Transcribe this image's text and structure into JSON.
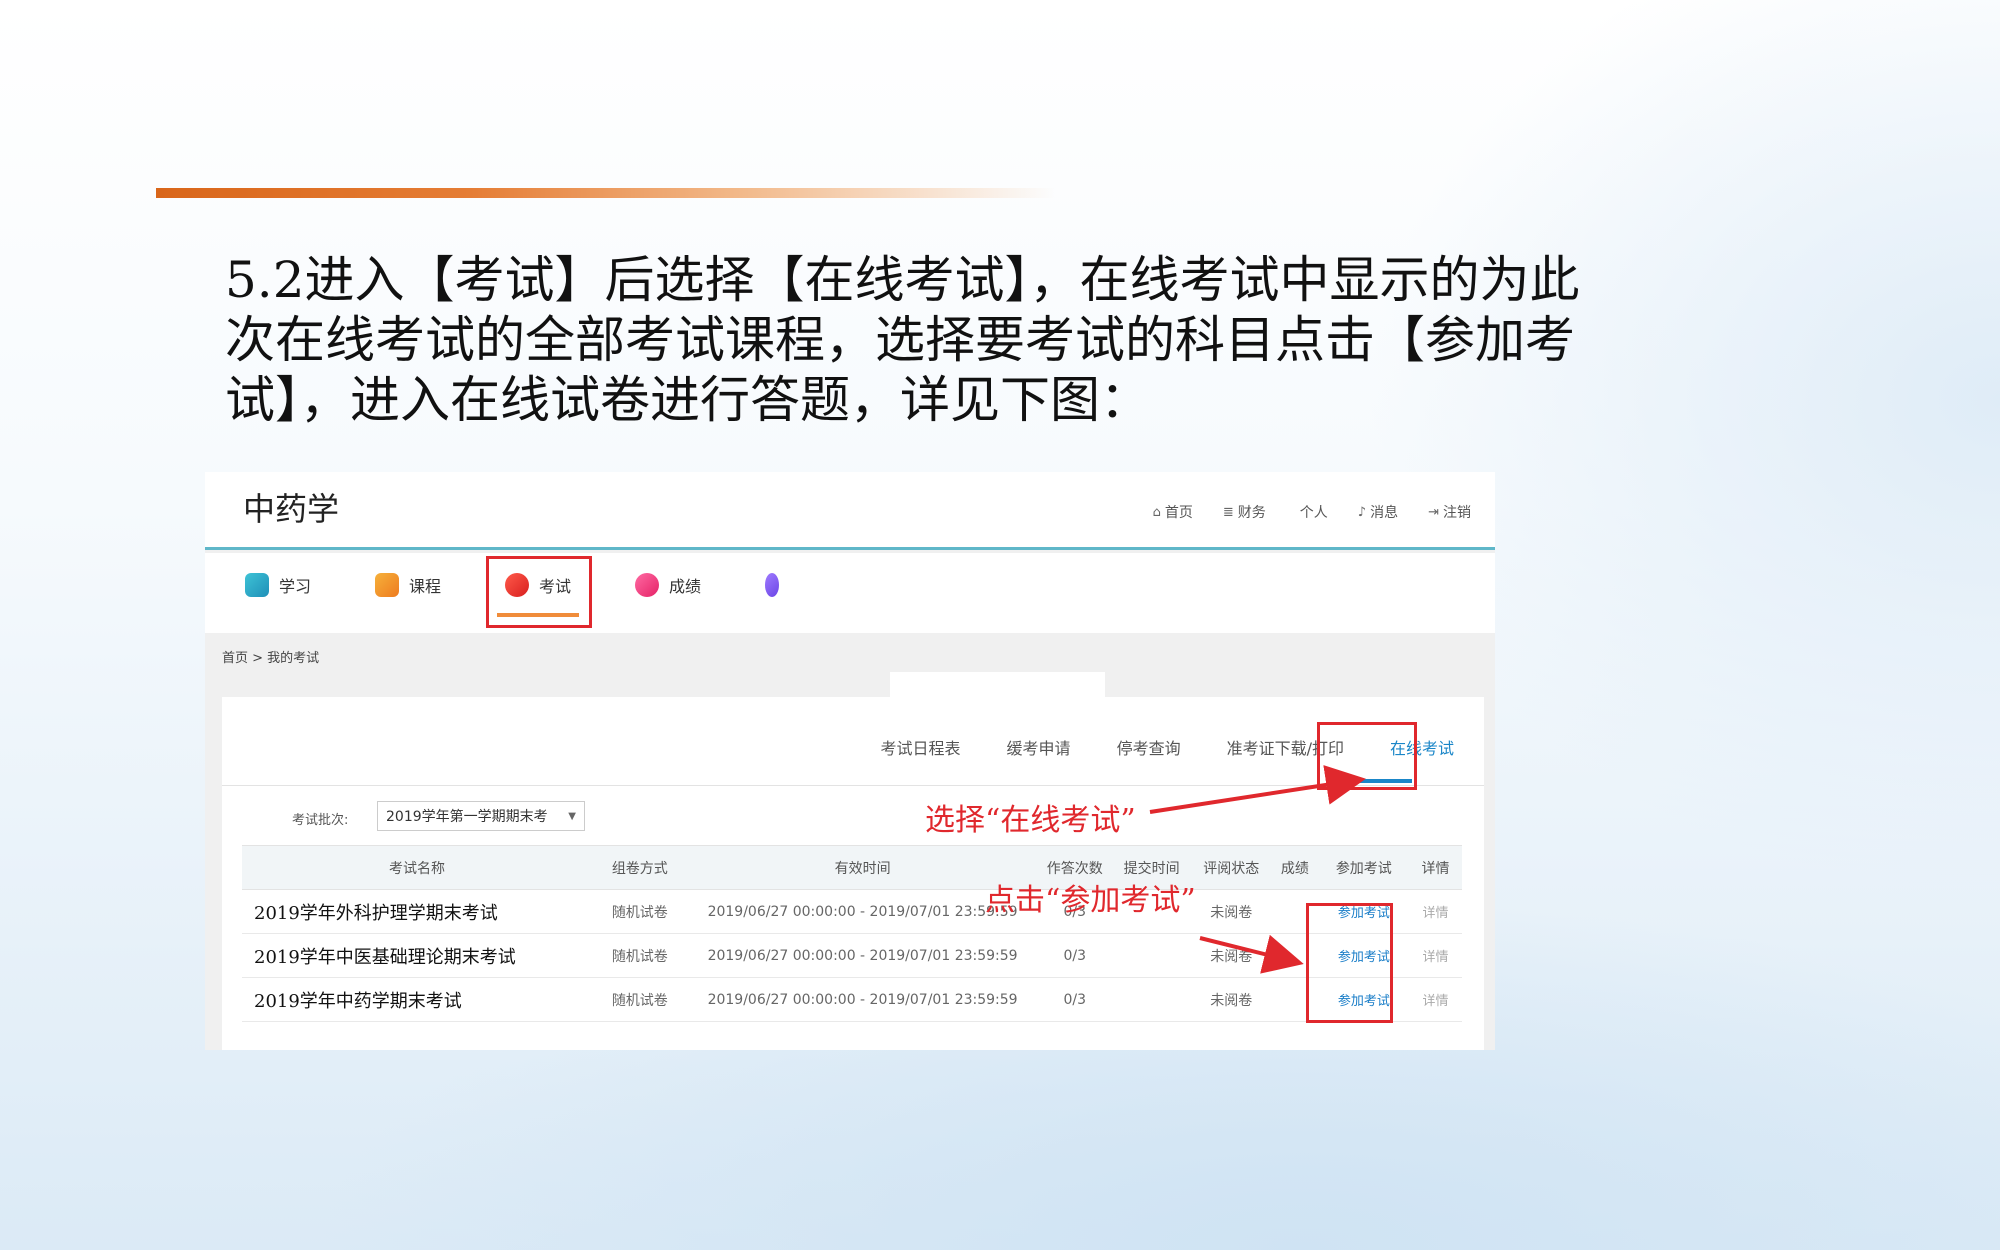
{
  "slide": {
    "intro_text": "5.2进入【考试】后选择【在线考试】，在线考试中显示的为此次在线考试的全部考试课程，选择要考试的科目点击【参加考试】，进入在线试卷进行答题，详见下图：",
    "accent": "#d9661a"
  },
  "app": {
    "title": "中药学",
    "topnav": [
      {
        "icon": "home-icon",
        "label": "首页"
      },
      {
        "icon": "database-icon",
        "label": "财务"
      },
      {
        "icon": "user-icon",
        "label": "个人"
      },
      {
        "icon": "bell-icon",
        "label": "消息"
      },
      {
        "icon": "logout-icon",
        "label": "注销"
      }
    ],
    "mainnav": [
      {
        "icon": "book-icon",
        "label": "学习"
      },
      {
        "icon": "course-icon",
        "label": "课程"
      },
      {
        "icon": "exam-icon",
        "label": "考试",
        "active": true
      },
      {
        "icon": "score-icon",
        "label": "成绩"
      }
    ],
    "breadcrumb": "首页 > 我的考试",
    "subtabs": [
      "考试日程表",
      "缓考申请",
      "停考查询",
      "准考证下载/打印",
      "在线考试"
    ],
    "active_subtab": "在线考试",
    "batch": {
      "label": "考试批次:",
      "value": "2019学年第一学期期末考"
    },
    "table": {
      "headers": [
        "考试名称",
        "组卷方式",
        "有效时间",
        "作答次数",
        "提交时间",
        "评阅状态",
        "成绩",
        "参加考试",
        "详情"
      ],
      "rows": [
        {
          "name": "2019学年外科护理学期末考试",
          "mode": "随机试卷",
          "time": "2019/06/27 00:00:00 - 2019/07/01 23:59:59",
          "attempts": "0/3",
          "submit": "",
          "status": "未阅卷",
          "score": "",
          "join": "参加考试",
          "detail": "详情"
        },
        {
          "name": "2019学年中医基础理论期末考试",
          "mode": "随机试卷",
          "time": "2019/06/27 00:00:00 - 2019/07/01 23:59:59",
          "attempts": "0/3",
          "submit": "",
          "status": "未阅卷",
          "score": "",
          "join": "参加考试",
          "detail": "详情"
        },
        {
          "name": "2019学年中药学期末考试",
          "mode": "随机试卷",
          "time": "2019/06/27 00:00:00 - 2019/07/01 23:59:59",
          "attempts": "0/3",
          "submit": "",
          "status": "未阅卷",
          "score": "",
          "join": "参加考试",
          "detail": "详情"
        }
      ]
    }
  },
  "annotations": {
    "select_online": "选择“在线考试”",
    "click_join": "点击“参加考试”",
    "color": "#e0282d"
  }
}
